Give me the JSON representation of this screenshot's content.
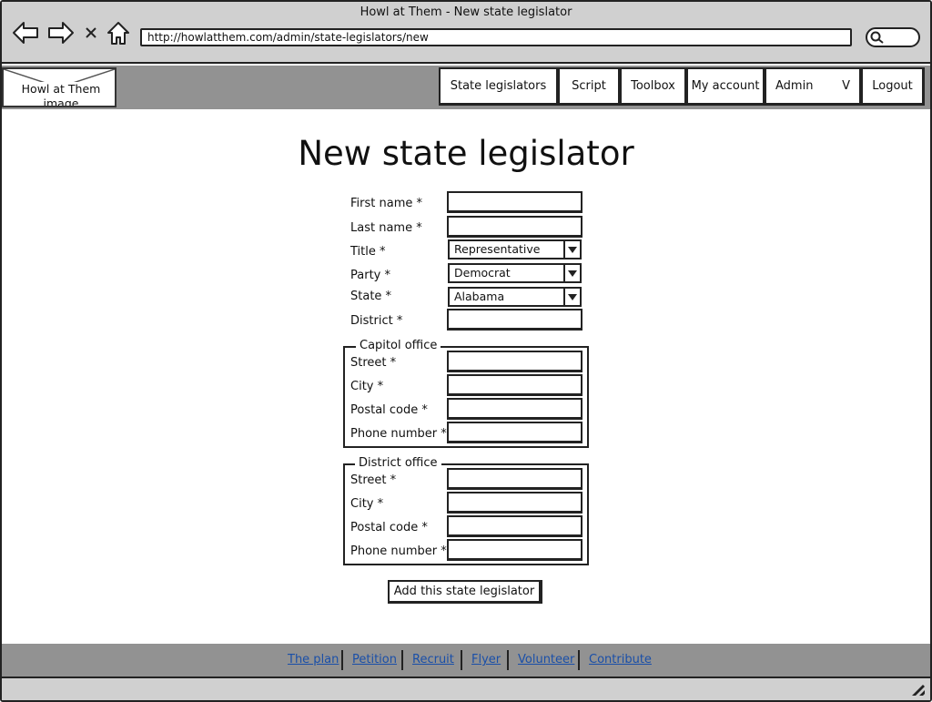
{
  "browser": {
    "window_title": "Howl at Them - New state legislator",
    "url": "http://howlatthem.com/admin/state-legislators/new"
  },
  "header": {
    "logo_label": "Howl at Them image",
    "nav": {
      "state_legislators": "State legislators",
      "script": "Script",
      "toolbox": "Toolbox",
      "my_account": "My account",
      "admin": "Admin",
      "admin_caret": "V",
      "logout": "Logout"
    }
  },
  "page": {
    "title": "New state legislator"
  },
  "form": {
    "first_name": {
      "label": "First name *",
      "value": ""
    },
    "last_name": {
      "label": "Last name *",
      "value": ""
    },
    "title": {
      "label": "Title *",
      "value": "Representative"
    },
    "party": {
      "label": "Party *",
      "value": "Democrat"
    },
    "state": {
      "label": "State *",
      "value": "Alabama"
    },
    "district": {
      "label": "District *",
      "value": ""
    },
    "capitol_office": {
      "legend": "Capitol office",
      "street": "Street *",
      "city": "City *",
      "postal_code": "Postal code *",
      "phone_number": "Phone number *"
    },
    "district_office": {
      "legend": "District office",
      "street": "Street *",
      "city": "City *",
      "postal_code": "Postal code *",
      "phone_number": "Phone number *"
    },
    "submit_label": "Add this state legislator"
  },
  "footer": {
    "links": {
      "plan": "The plan",
      "petition": "Petition",
      "recruit": "Recruit",
      "flyer": "Flyer",
      "volunteer": "Volunteer",
      "contribute": "Contribute"
    },
    "link_color": "#1a4fa8"
  }
}
